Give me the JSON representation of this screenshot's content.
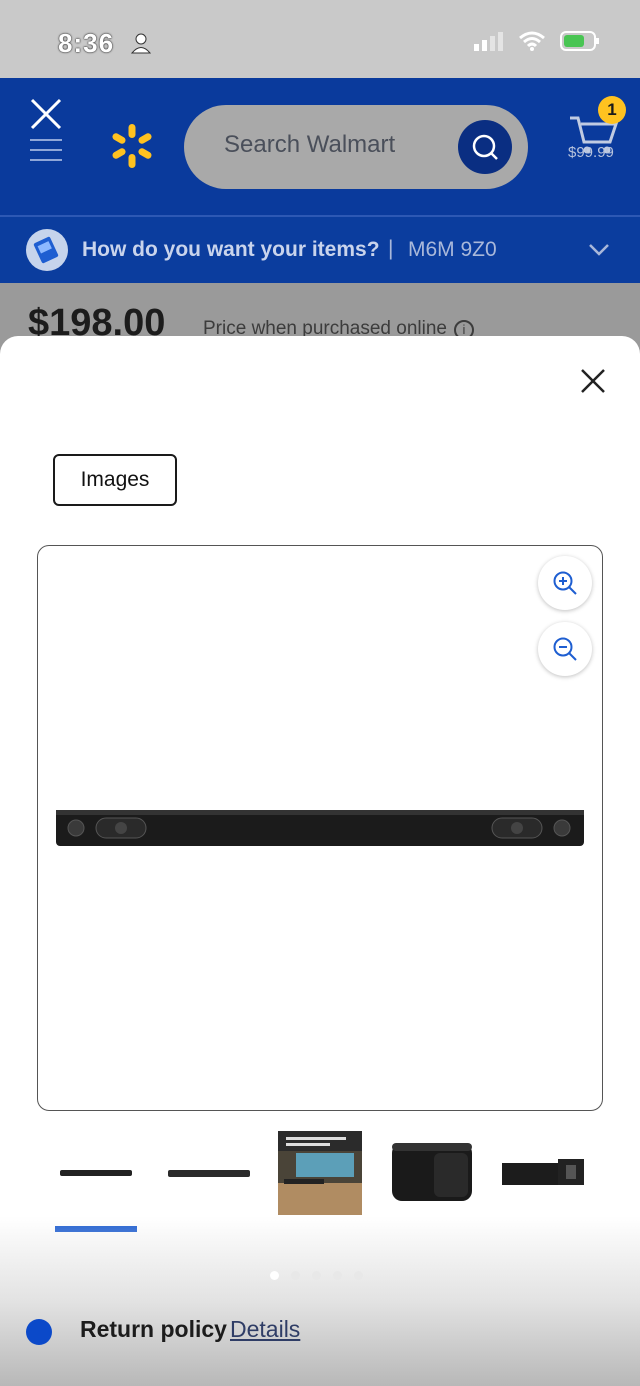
{
  "status_bar": {
    "time": "8:36"
  },
  "header": {
    "search": {
      "placeholder": "Search Walmart"
    },
    "cart": {
      "count": "1",
      "total": "$99.99"
    }
  },
  "delivery": {
    "question": "How do you want your items?",
    "separator": "|",
    "postal_code": "M6M 9Z0"
  },
  "background_page": {
    "price": "$198.00",
    "price_note": "Price when purchased online",
    "info_icon": "i",
    "return_policy_label": "Return policy",
    "return_policy_link": "Details"
  },
  "modal": {
    "tab_label": "Images",
    "thumbnails": [
      {
        "name": "soundbar-front",
        "selected": true
      },
      {
        "name": "soundbar-angle",
        "selected": false
      },
      {
        "name": "lifestyle-promo",
        "selected": false
      },
      {
        "name": "subwoofer",
        "selected": false
      },
      {
        "name": "soundbar-end",
        "selected": false
      }
    ],
    "pagination": {
      "count": 5,
      "active": 1
    }
  },
  "colors": {
    "walmart_blue": "#0a3a9c",
    "spark_yellow": "#ffc220",
    "selection_blue": "#1e5ed1"
  }
}
